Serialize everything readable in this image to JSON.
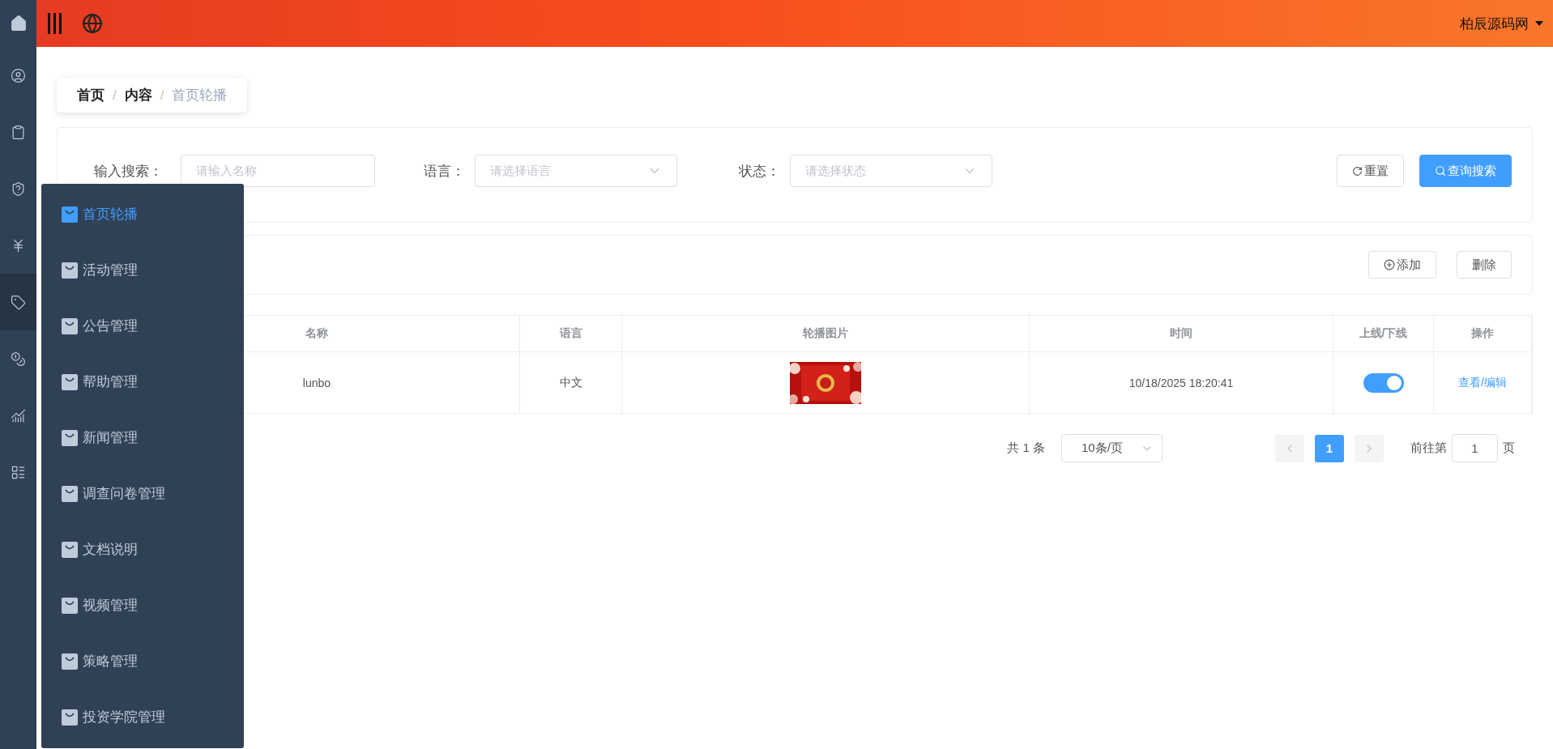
{
  "rail_items": [
    {
      "selected": false
    },
    {
      "selected": false
    },
    {
      "selected": false
    },
    {
      "selected": false
    },
    {
      "selected": false
    },
    {
      "selected": true
    },
    {
      "selected": false
    },
    {
      "selected": false
    },
    {
      "selected": false
    }
  ],
  "header": {
    "user": "柏辰源码网"
  },
  "breadcrumb": [
    {
      "label": "首页",
      "current": false
    },
    {
      "separator": "/",
      "label": "内容",
      "current": false
    },
    {
      "separator": "/",
      "label": "首页轮播",
      "current": true
    }
  ],
  "filters": [
    {
      "kind": "input",
      "label": "输入搜索：",
      "placeholder": "请输入名称"
    },
    {
      "kind": "select",
      "label": "语言：",
      "placeholder": "请选择语言"
    },
    {
      "kind": "select",
      "label": "状态：",
      "placeholder": "请选择状态"
    }
  ],
  "filter_buttons": {
    "reset": "重置",
    "search": "查询搜索"
  },
  "toolbar": {
    "add": "添加",
    "delete": "删除"
  },
  "table": {
    "columns": [
      "名称",
      "语言",
      "轮播图片",
      "时间",
      "上线/下线",
      "操作"
    ],
    "rows": [
      {
        "name": "lunbo",
        "language": "中文",
        "time": "10/18/2025 18:20:41",
        "online": true,
        "action": "查看/编辑"
      }
    ]
  },
  "pagination": {
    "total": "共 1 条",
    "page_size": "10条/页",
    "pages": [
      {
        "label": "1",
        "selected": true
      }
    ],
    "goto_label": "前往第",
    "goto_value": "1",
    "goto_suffix": "页"
  },
  "popup_menu": [
    {
      "label": "首页轮播",
      "selected": true
    },
    {
      "label": "活动管理",
      "selected": false
    },
    {
      "label": "公告管理",
      "selected": false
    },
    {
      "label": "帮助管理",
      "selected": false
    },
    {
      "label": "新闻管理",
      "selected": false
    },
    {
      "label": "调查问卷管理",
      "selected": false
    },
    {
      "label": "文档说明",
      "selected": false
    },
    {
      "label": "视频管理",
      "selected": false
    },
    {
      "label": "策略管理",
      "selected": false
    },
    {
      "label": "投资学院管理",
      "selected": false
    }
  ]
}
